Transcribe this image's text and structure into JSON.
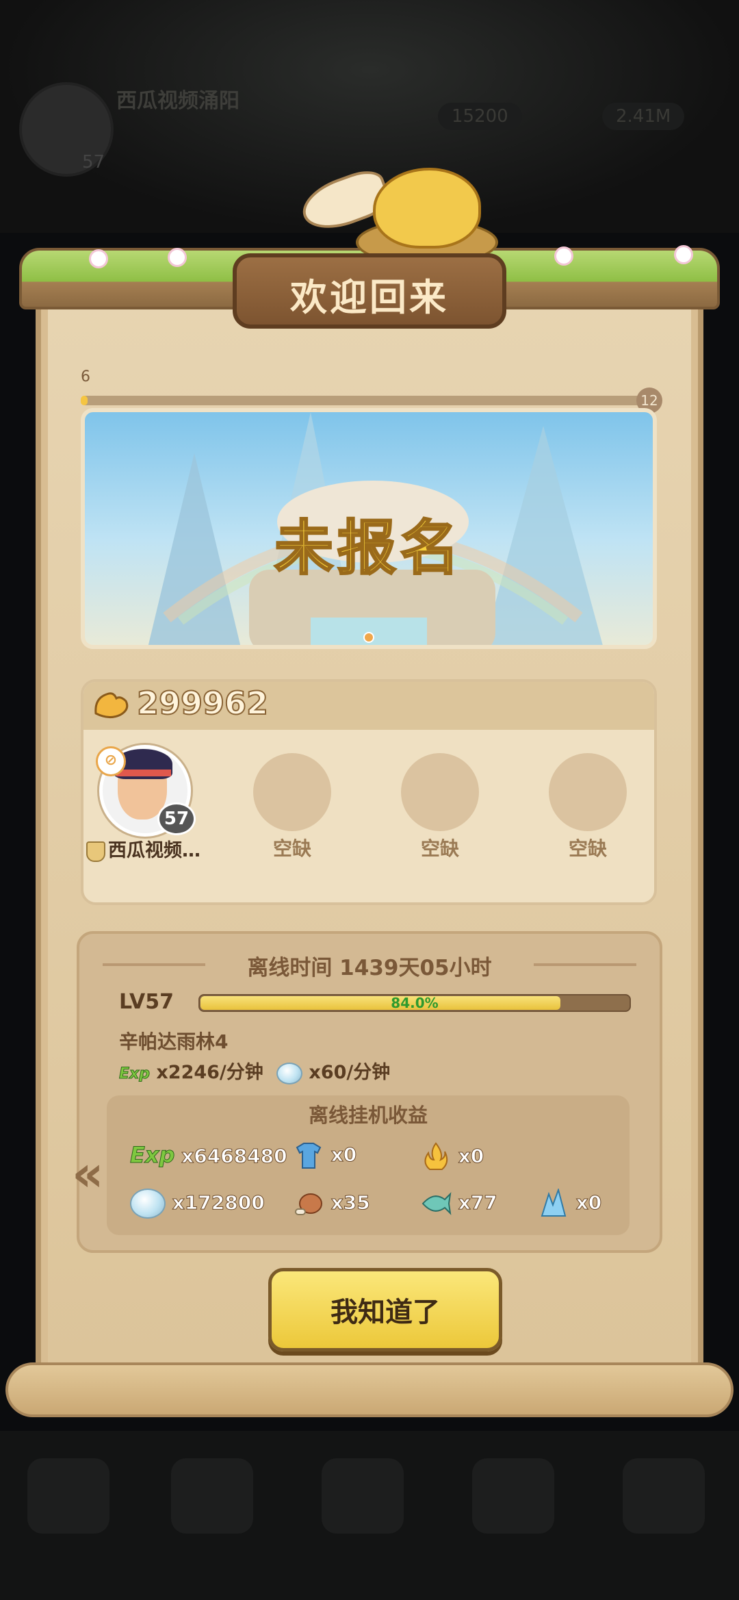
{
  "background": {
    "player_name": "西瓜视频涌阳",
    "player_level": "57",
    "resource_1": "15200",
    "resource_2": "2.41M"
  },
  "dialog": {
    "title": "欢迎回来",
    "progress": {
      "start": "6",
      "end": "12"
    },
    "banner_status": "未报名",
    "power_value": "299962",
    "team": {
      "hero": {
        "name": "西瓜视频…",
        "level": "57"
      },
      "empty_slots": [
        "空缺",
        "空缺",
        "空缺"
      ]
    },
    "offline": {
      "time_text": "离线时间 1439天05小时",
      "level_label": "LV57",
      "exp_percent_text": "84.0%",
      "exp_fraction": 0.84,
      "map_name": "辛帕达雨林4",
      "exp_rate": "x2246/分钟",
      "crystal_rate": "x60/分钟",
      "exp_tag": "Exp",
      "rewards_title": "离线挂机收益",
      "rewards": [
        {
          "icon": "exp-icon",
          "label": "Exp",
          "amount": "x6468480"
        },
        {
          "icon": "shirt-icon",
          "amount": "x0"
        },
        {
          "icon": "flame-icon",
          "amount": "x0"
        },
        {
          "icon": "crystal-icon",
          "amount": "x172800"
        },
        {
          "icon": "meat-icon",
          "amount": "x35"
        },
        {
          "icon": "fish-icon",
          "amount": "x77"
        },
        {
          "icon": "ice-shard-icon",
          "amount": "x0"
        }
      ]
    },
    "confirm_label": "我知道了"
  },
  "colors": {
    "accent_yellow": "#f6d03c",
    "panel": "#e7d4b1",
    "exp_green": "#2e9a2e"
  }
}
